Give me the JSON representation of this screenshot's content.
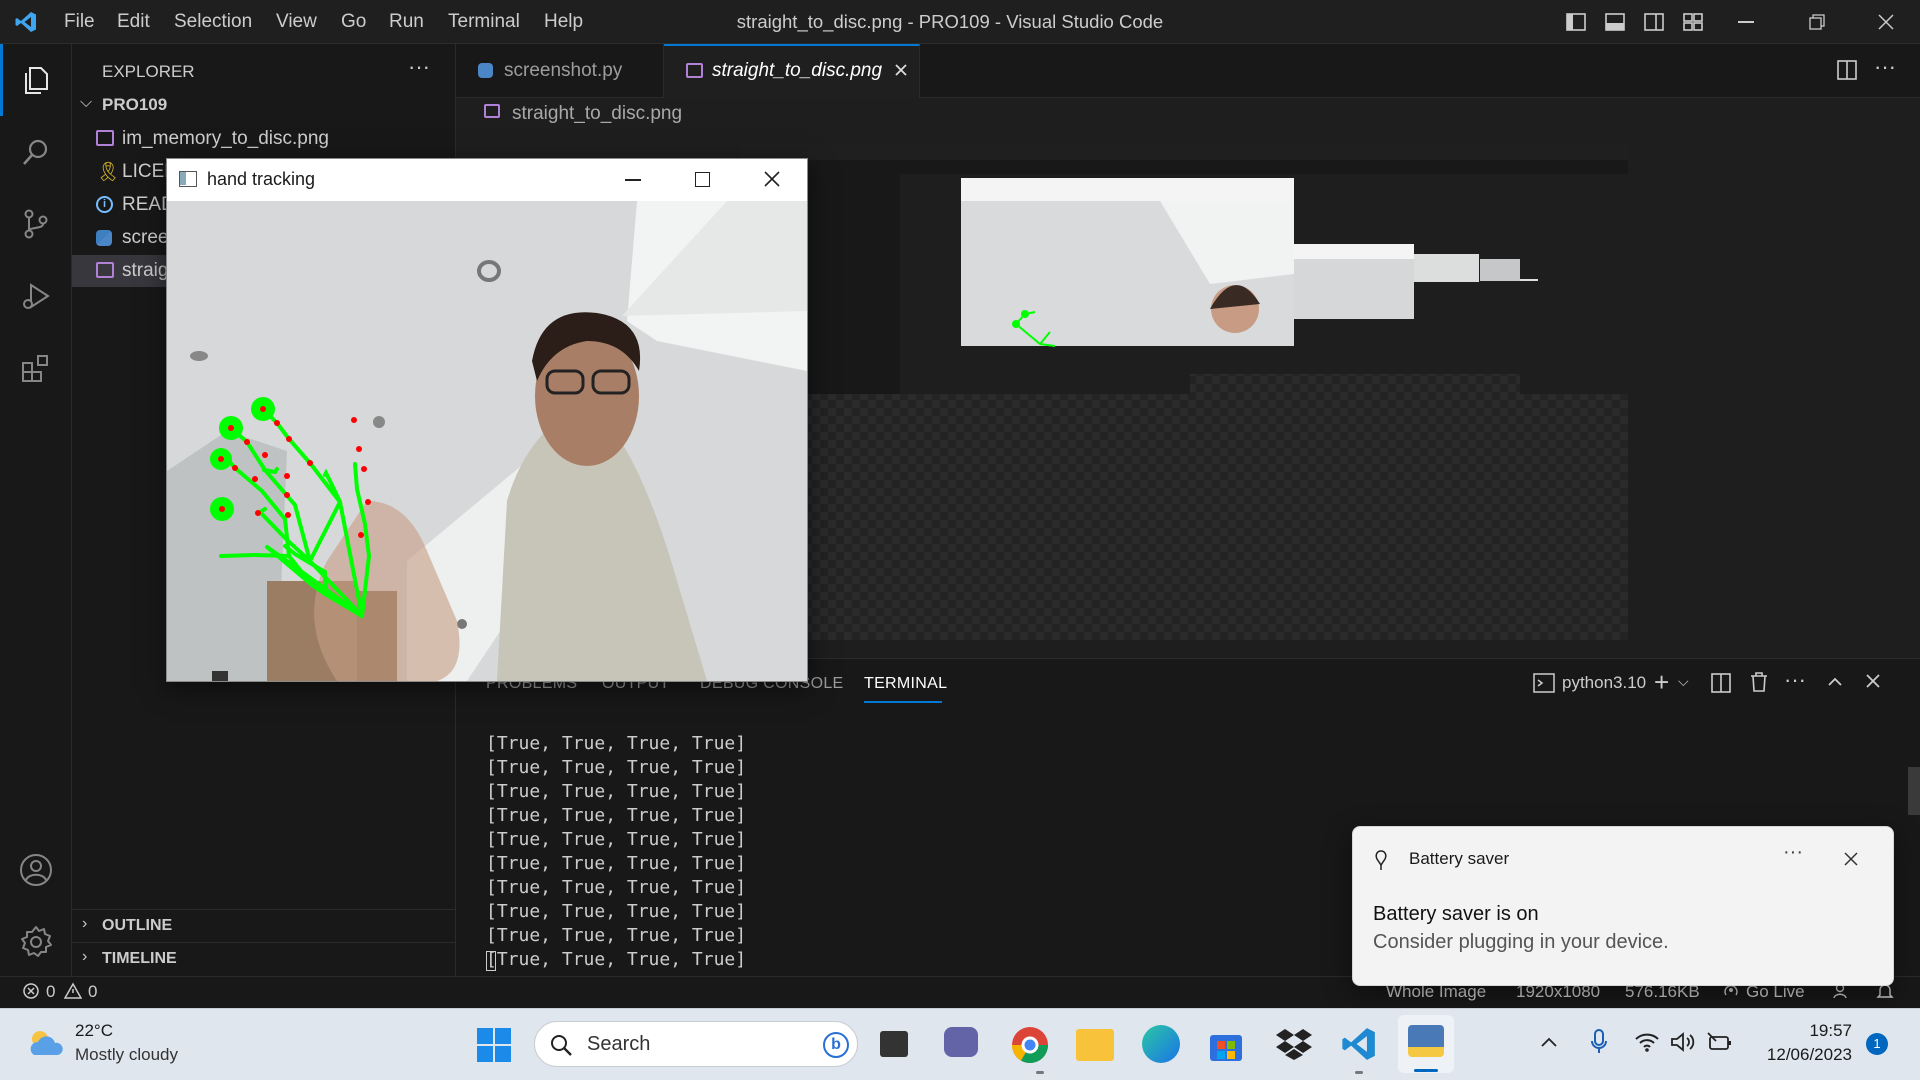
{
  "window": {
    "title": "straight_to_disc.png - PRO109 - Visual Studio Code",
    "menu": [
      "File",
      "Edit",
      "Selection",
      "View",
      "Go",
      "Run",
      "Terminal",
      "Help"
    ]
  },
  "sidebar": {
    "header": "EXPLORER",
    "folder": "PRO109",
    "files": [
      {
        "name": "im_memory_to_disc.png",
        "icon": "image-file-icon"
      },
      {
        "name": "LICENSE",
        "icon": "license-file-icon"
      },
      {
        "name": "README.md",
        "icon": "info-file-icon"
      },
      {
        "name": "screenshot.py",
        "icon": "python-file-icon"
      },
      {
        "name": "straight_to_disc.png",
        "icon": "image-file-icon"
      }
    ],
    "outline": "OUTLINE",
    "timeline": "TIMELINE"
  },
  "tabs": [
    {
      "label": "screenshot.py",
      "active": false
    },
    {
      "label": "straight_to_disc.png",
      "active": true
    }
  ],
  "breadcrumb": "straight_to_disc.png",
  "panel": {
    "tabs": [
      "PROBLEMS",
      "OUTPUT",
      "DEBUG CONSOLE",
      "TERMINAL"
    ],
    "active_tab": "TERMINAL",
    "terminal_profile": "python3.10",
    "lines": [
      "[True, True, True, True]",
      "[True, True, True, True]",
      "[True, True, True, True]",
      "[True, True, True, True]",
      "[True, True, True, True]",
      "[True, True, True, True]",
      "[True, True, True, True]",
      "[True, True, True, True]",
      "[True, True, True, True]",
      "[True, True, True, True]"
    ]
  },
  "statusbar": {
    "errors": "0",
    "warnings": "0",
    "image_size_mode": "Whole Image",
    "dimensions": "1920x1080",
    "file_size": "576.16KB",
    "go_live": "Go Live"
  },
  "hand_window": {
    "title": "hand tracking"
  },
  "notification": {
    "app": "Battery saver",
    "heading": "Battery saver is on",
    "body": "Consider plugging in your device."
  },
  "taskbar": {
    "weather_temp": "22°C",
    "weather_desc": "Mostly cloudy",
    "search_placeholder": "Search",
    "time": "19:57",
    "date": "12/06/2023",
    "notification_count": "1"
  },
  "colors": {
    "accent": "#0078d4",
    "landmark_green": "#00ff00",
    "landmark_red": "#ff0000"
  }
}
